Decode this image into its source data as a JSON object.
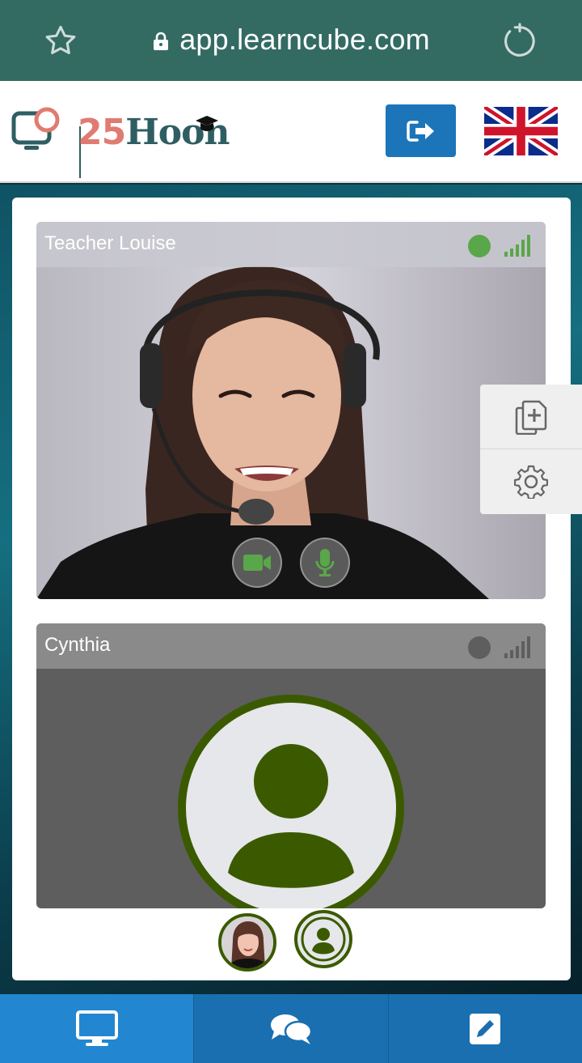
{
  "browser": {
    "url": "app.learncube.com"
  },
  "header": {
    "logo_number": "25",
    "logo_word": "Hoon"
  },
  "participants": [
    {
      "name": "Teacher Louise",
      "status_color": "#5aa64a",
      "signal_color": "#5aa64a"
    },
    {
      "name": "Cynthia",
      "status_color": "#5e5e5e",
      "signal_color": "#5e5e5e"
    }
  ],
  "colors": {
    "browser_bar": "#336b63",
    "accent_blue": "#1b75b8",
    "avatar_green": "#3b5a00",
    "brand_coral": "#e07b72",
    "brand_teal": "#2f5e62"
  },
  "icons": {
    "bookmark": "star-icon",
    "lock": "lock-icon",
    "reload": "reload-icon",
    "logout": "logout-icon",
    "language": "uk-flag-icon",
    "add_document": "copy-plus-icon",
    "settings": "gear-icon",
    "camera": "video-camera-icon",
    "microphone": "microphone-icon",
    "nav": [
      "monitor-icon",
      "chat-icon",
      "edit-icon"
    ]
  }
}
